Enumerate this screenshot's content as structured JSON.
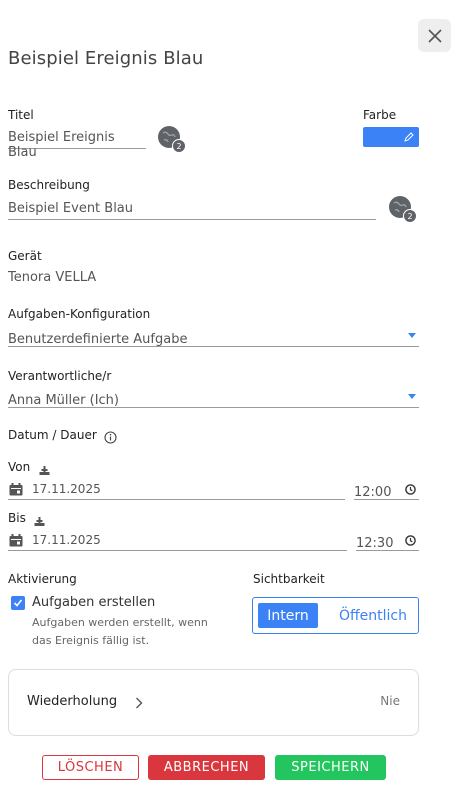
{
  "dialog": {
    "title": "Beispiel Ereignis Blau"
  },
  "title_field": {
    "label": "Titel",
    "value": "Beispiel Ereignis Blau",
    "translations_count": "2"
  },
  "color_field": {
    "label": "Farbe",
    "value": "#3b82f6"
  },
  "description_field": {
    "label": "Beschreibung",
    "value": "Beispiel Event Blau",
    "translations_count": "2"
  },
  "device": {
    "label": "Gerät",
    "value": "Tenora VELLA"
  },
  "task_config": {
    "label": "Aufgaben-Konfiguration",
    "value": "Benutzerdefinierte Aufgabe"
  },
  "responsible": {
    "label": "Verantwortliche/r",
    "value": "Anna Müller (Ich)"
  },
  "schedule": {
    "label": "Datum / Dauer",
    "from_label": "Von",
    "from_date": "17.11.2025",
    "from_time": "12:00",
    "to_label": "Bis",
    "to_date": "17.11.2025",
    "to_time": "12:30"
  },
  "activation": {
    "label": "Aktivierung",
    "checkbox_label": "Aufgaben erstellen",
    "checked": true,
    "hint_line1": "Aufgaben werden erstellt, wenn",
    "hint_line2": "das Ereignis fällig ist."
  },
  "visibility": {
    "label": "Sichtbarkeit",
    "option_internal": "Intern",
    "option_public": "Öffentlich",
    "selected": "Intern"
  },
  "repeat": {
    "label": "Wiederholung",
    "value": "Nie"
  },
  "actions": {
    "delete": "LÖSCHEN",
    "cancel": "ABBRECHEN",
    "save": "SPEICHERN"
  },
  "colors": {
    "accent": "#3b82f6",
    "danger": "#d9363e",
    "success": "#22c55e"
  }
}
